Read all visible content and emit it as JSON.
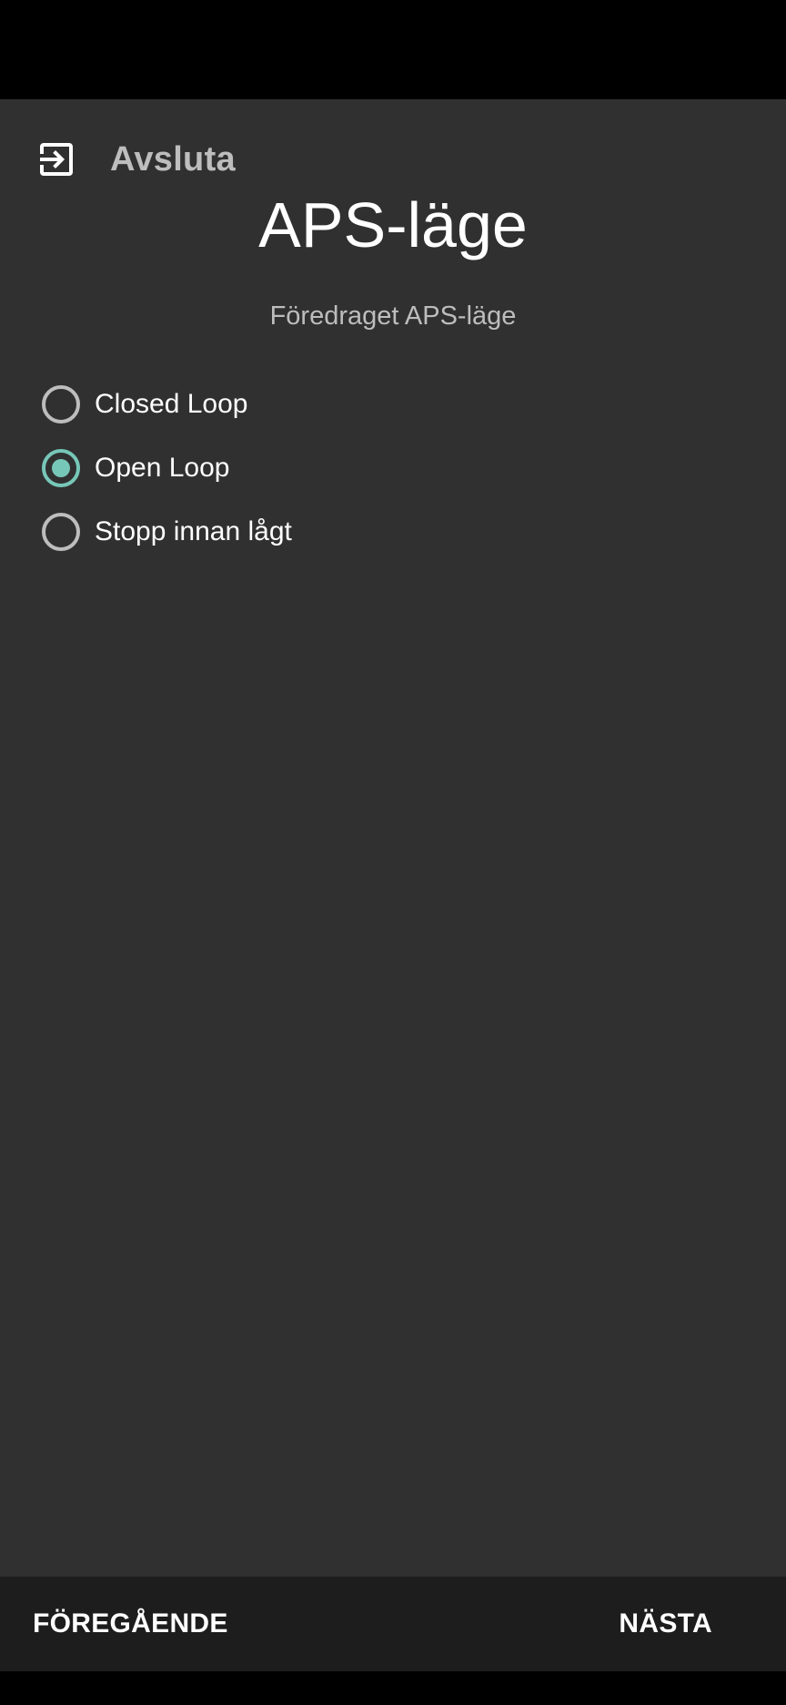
{
  "header": {
    "exit_label": "Avsluta",
    "exit_icon": "exit-to-app-icon"
  },
  "main": {
    "title": "APS-läge",
    "subtitle": "Föredraget APS-läge",
    "options": [
      {
        "label": "Closed Loop",
        "checked": false
      },
      {
        "label": "Open Loop",
        "checked": true
      },
      {
        "label": "Stopp innan lågt",
        "checked": false
      }
    ]
  },
  "footer": {
    "previous_label": "FÖREGÅENDE",
    "next_label": "NÄSTA"
  },
  "colors": {
    "background": "#303030",
    "accent": "#77c7b8",
    "bottom_bar": "#1d1d1d",
    "muted_text": "#bdbdbd"
  }
}
